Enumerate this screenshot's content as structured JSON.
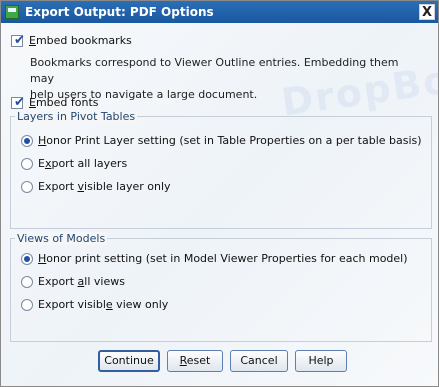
{
  "window": {
    "title": "Export Output: PDF Options",
    "close_glyph": "X"
  },
  "watermark_text": "DropBo",
  "options": {
    "embed_bookmarks": {
      "label_first": "E",
      "label_rest": "mbed bookmarks",
      "checked": true
    },
    "bookmarks_desc": [
      "Bookmarks correspond to Viewer Outline entries. Embedding them may",
      "help users to navigate a large document."
    ],
    "embed_fonts": {
      "label_first": "E",
      "label_rest": "mbed fonts",
      "checked": true
    }
  },
  "layers_group": {
    "title": "Layers in Pivot Tables",
    "options": [
      {
        "label_first": "H",
        "label_rest": "onor Print Layer setting (set in Table Properties on a per table basis)",
        "selected": true
      },
      {
        "label_first": "E",
        "label_mid_u": "x",
        "label_rest": "port all layers",
        "selected": false
      },
      {
        "label_pre": "Export ",
        "label_u": "v",
        "label_rest": "isible layer only",
        "selected": false
      }
    ]
  },
  "models_group": {
    "title": "Views of Models",
    "options": [
      {
        "label_first": "H",
        "label_rest": "onor print setting (set in Model Viewer Properties for each model)",
        "selected": true
      },
      {
        "label_pre": "Export ",
        "label_u": "a",
        "label_rest": "ll views",
        "selected": false
      },
      {
        "label_pre": "Export visibl",
        "label_u": "e",
        "label_rest": " view only",
        "selected": false
      }
    ]
  },
  "buttons": {
    "continue": "Continue",
    "reset_u": "R",
    "reset_rest": "eset",
    "cancel": "Cancel",
    "help": "Help"
  }
}
